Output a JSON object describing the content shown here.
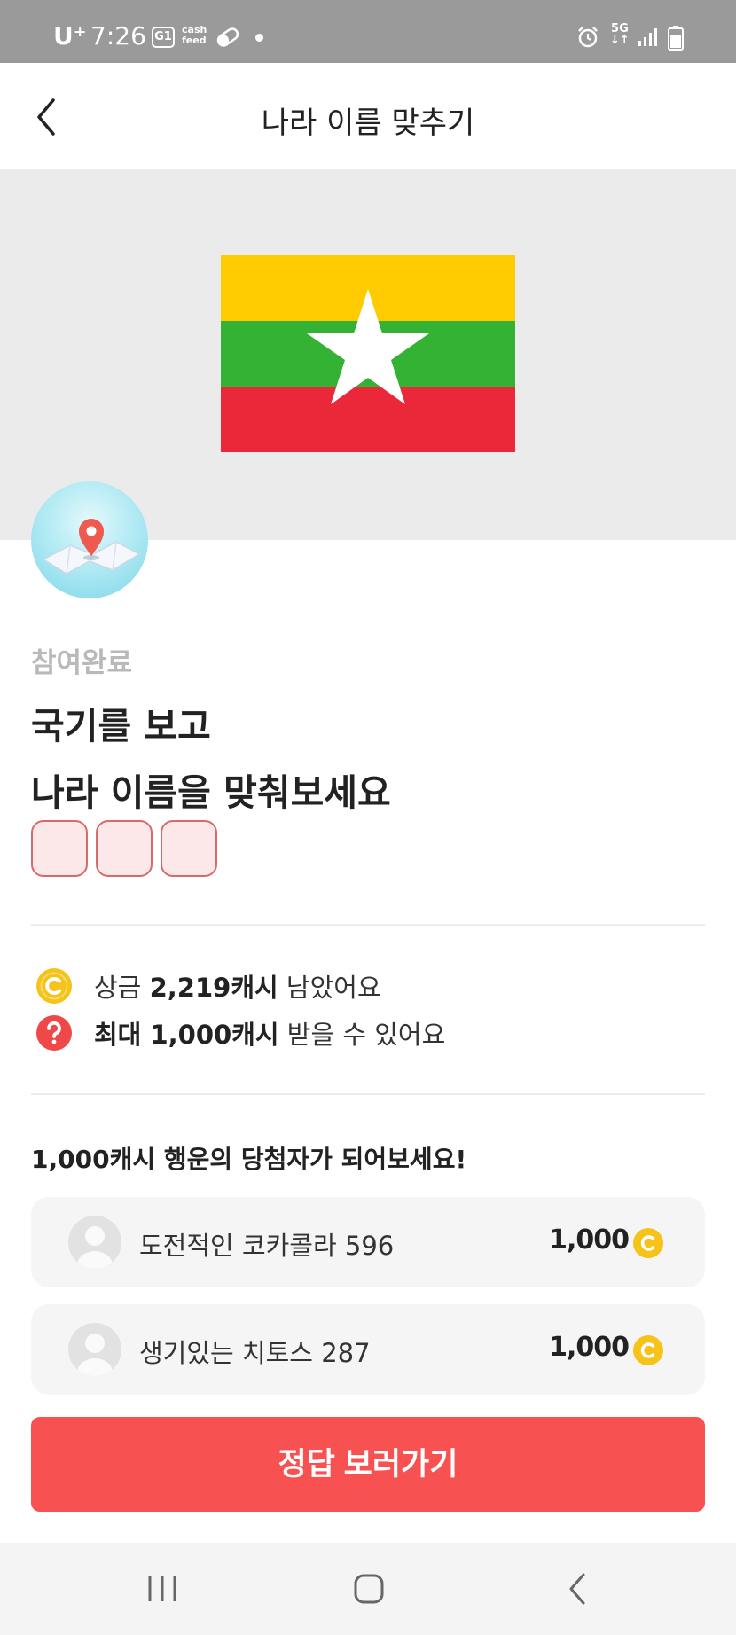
{
  "status_bar": {
    "carrier": "U⁺",
    "time": "7:26",
    "app_badge": "G1",
    "cashfeed_line1": "cash",
    "cashfeed_line2": "feed",
    "network": "5G"
  },
  "header": {
    "title": "나라 이름 맞추기",
    "back_icon": "chevron-left-icon"
  },
  "quiz": {
    "flag_colors": {
      "top": "#FECB00",
      "middle": "#34B233",
      "bottom": "#EA2839",
      "star": "#FFFFFF"
    },
    "status": "참여완료",
    "title_line1": "국기를 보고",
    "title_line2": "나라 이름을 맞춰보세요",
    "answer_box_count": 3
  },
  "info": {
    "prize_label": "상금",
    "prize_amount": "2,219캐시",
    "prize_suffix": "남았어요",
    "max_label": "최대 1,000캐시",
    "max_suffix": "받을 수 있어요"
  },
  "winners": {
    "title": "1,000캐시 행운의 당첨자가 되어보세요!",
    "items": [
      {
        "name": "도전적인 코카콜라 596",
        "amount": "1,000"
      },
      {
        "name": "생기있는 치토스 287",
        "amount": "1,000"
      }
    ]
  },
  "cta": {
    "label": "정답 보러가기"
  },
  "colors": {
    "accent": "#F85151",
    "coin": "#F6C31B",
    "help": "#F04848"
  },
  "nav": {
    "icons": [
      "recent-apps-icon",
      "home-icon",
      "back-icon"
    ]
  }
}
